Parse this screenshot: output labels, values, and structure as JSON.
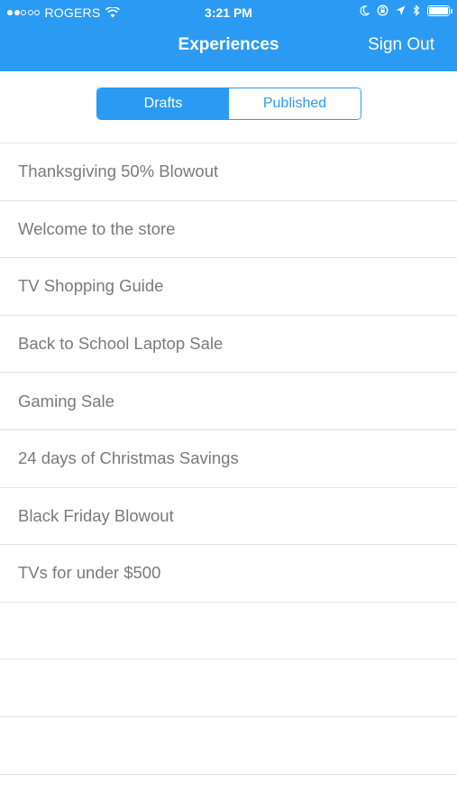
{
  "status_bar": {
    "carrier": "ROGERS",
    "time": "3:21 PM",
    "signal_dots": [
      "full",
      "full",
      "empty",
      "empty",
      "empty"
    ],
    "icons": [
      "wifi-icon",
      "moon-icon",
      "rotation-lock-icon",
      "location-arrow-icon",
      "bluetooth-icon",
      "battery-icon"
    ],
    "battery_level": 1.0
  },
  "nav": {
    "title": "Experiences",
    "sign_out_label": "Sign Out",
    "accent_color": "#2b9af3"
  },
  "segmented_control": {
    "options": [
      {
        "label": "Drafts",
        "selected": true
      },
      {
        "label": "Published",
        "selected": false
      }
    ]
  },
  "experiences": [
    "Thanksgiving 50% Blowout",
    "Welcome to the store",
    "TV Shopping Guide",
    "Back to School Laptop Sale",
    "Gaming Sale",
    "24 days of Christmas Savings",
    "Black Friday Blowout",
    "TVs for under $500"
  ]
}
